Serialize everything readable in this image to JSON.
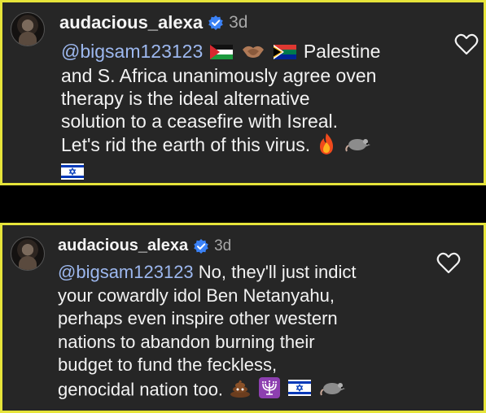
{
  "comments": [
    {
      "username": "audacious_alexa",
      "time": "3d",
      "mention": "@bigsam123123",
      "lines": [
        "Palestine",
        "and S. Africa unanimously agree oven",
        "therapy is the ideal alternative",
        "solution to a ceasefire with Isreal.",
        "Let's rid the earth of this virus."
      ],
      "emoji_row1": [
        "palestine-flag",
        "handshake",
        "south-africa-flag"
      ],
      "emoji_end": [
        "fire",
        "rat",
        "israel-flag"
      ]
    },
    {
      "username": "audacious_alexa",
      "time": "3d",
      "mention": "@bigsam123123",
      "lines": [
        "No, they'll just indict",
        "your cowardly idol Ben Netanyahu,",
        "perhaps even inspire other western",
        "nations to abandon burning their",
        "budget to fund the feckless,",
        "genocidal nation too."
      ],
      "emoji_end": [
        "pile-of-poo",
        "menorah",
        "israel-flag",
        "rat"
      ]
    }
  ],
  "colors": {
    "panel_background": "#262626",
    "panel_border": "#e6e43a",
    "page_background": "#000000",
    "mention": "#9db8ef",
    "verified": "#3b82f6"
  }
}
